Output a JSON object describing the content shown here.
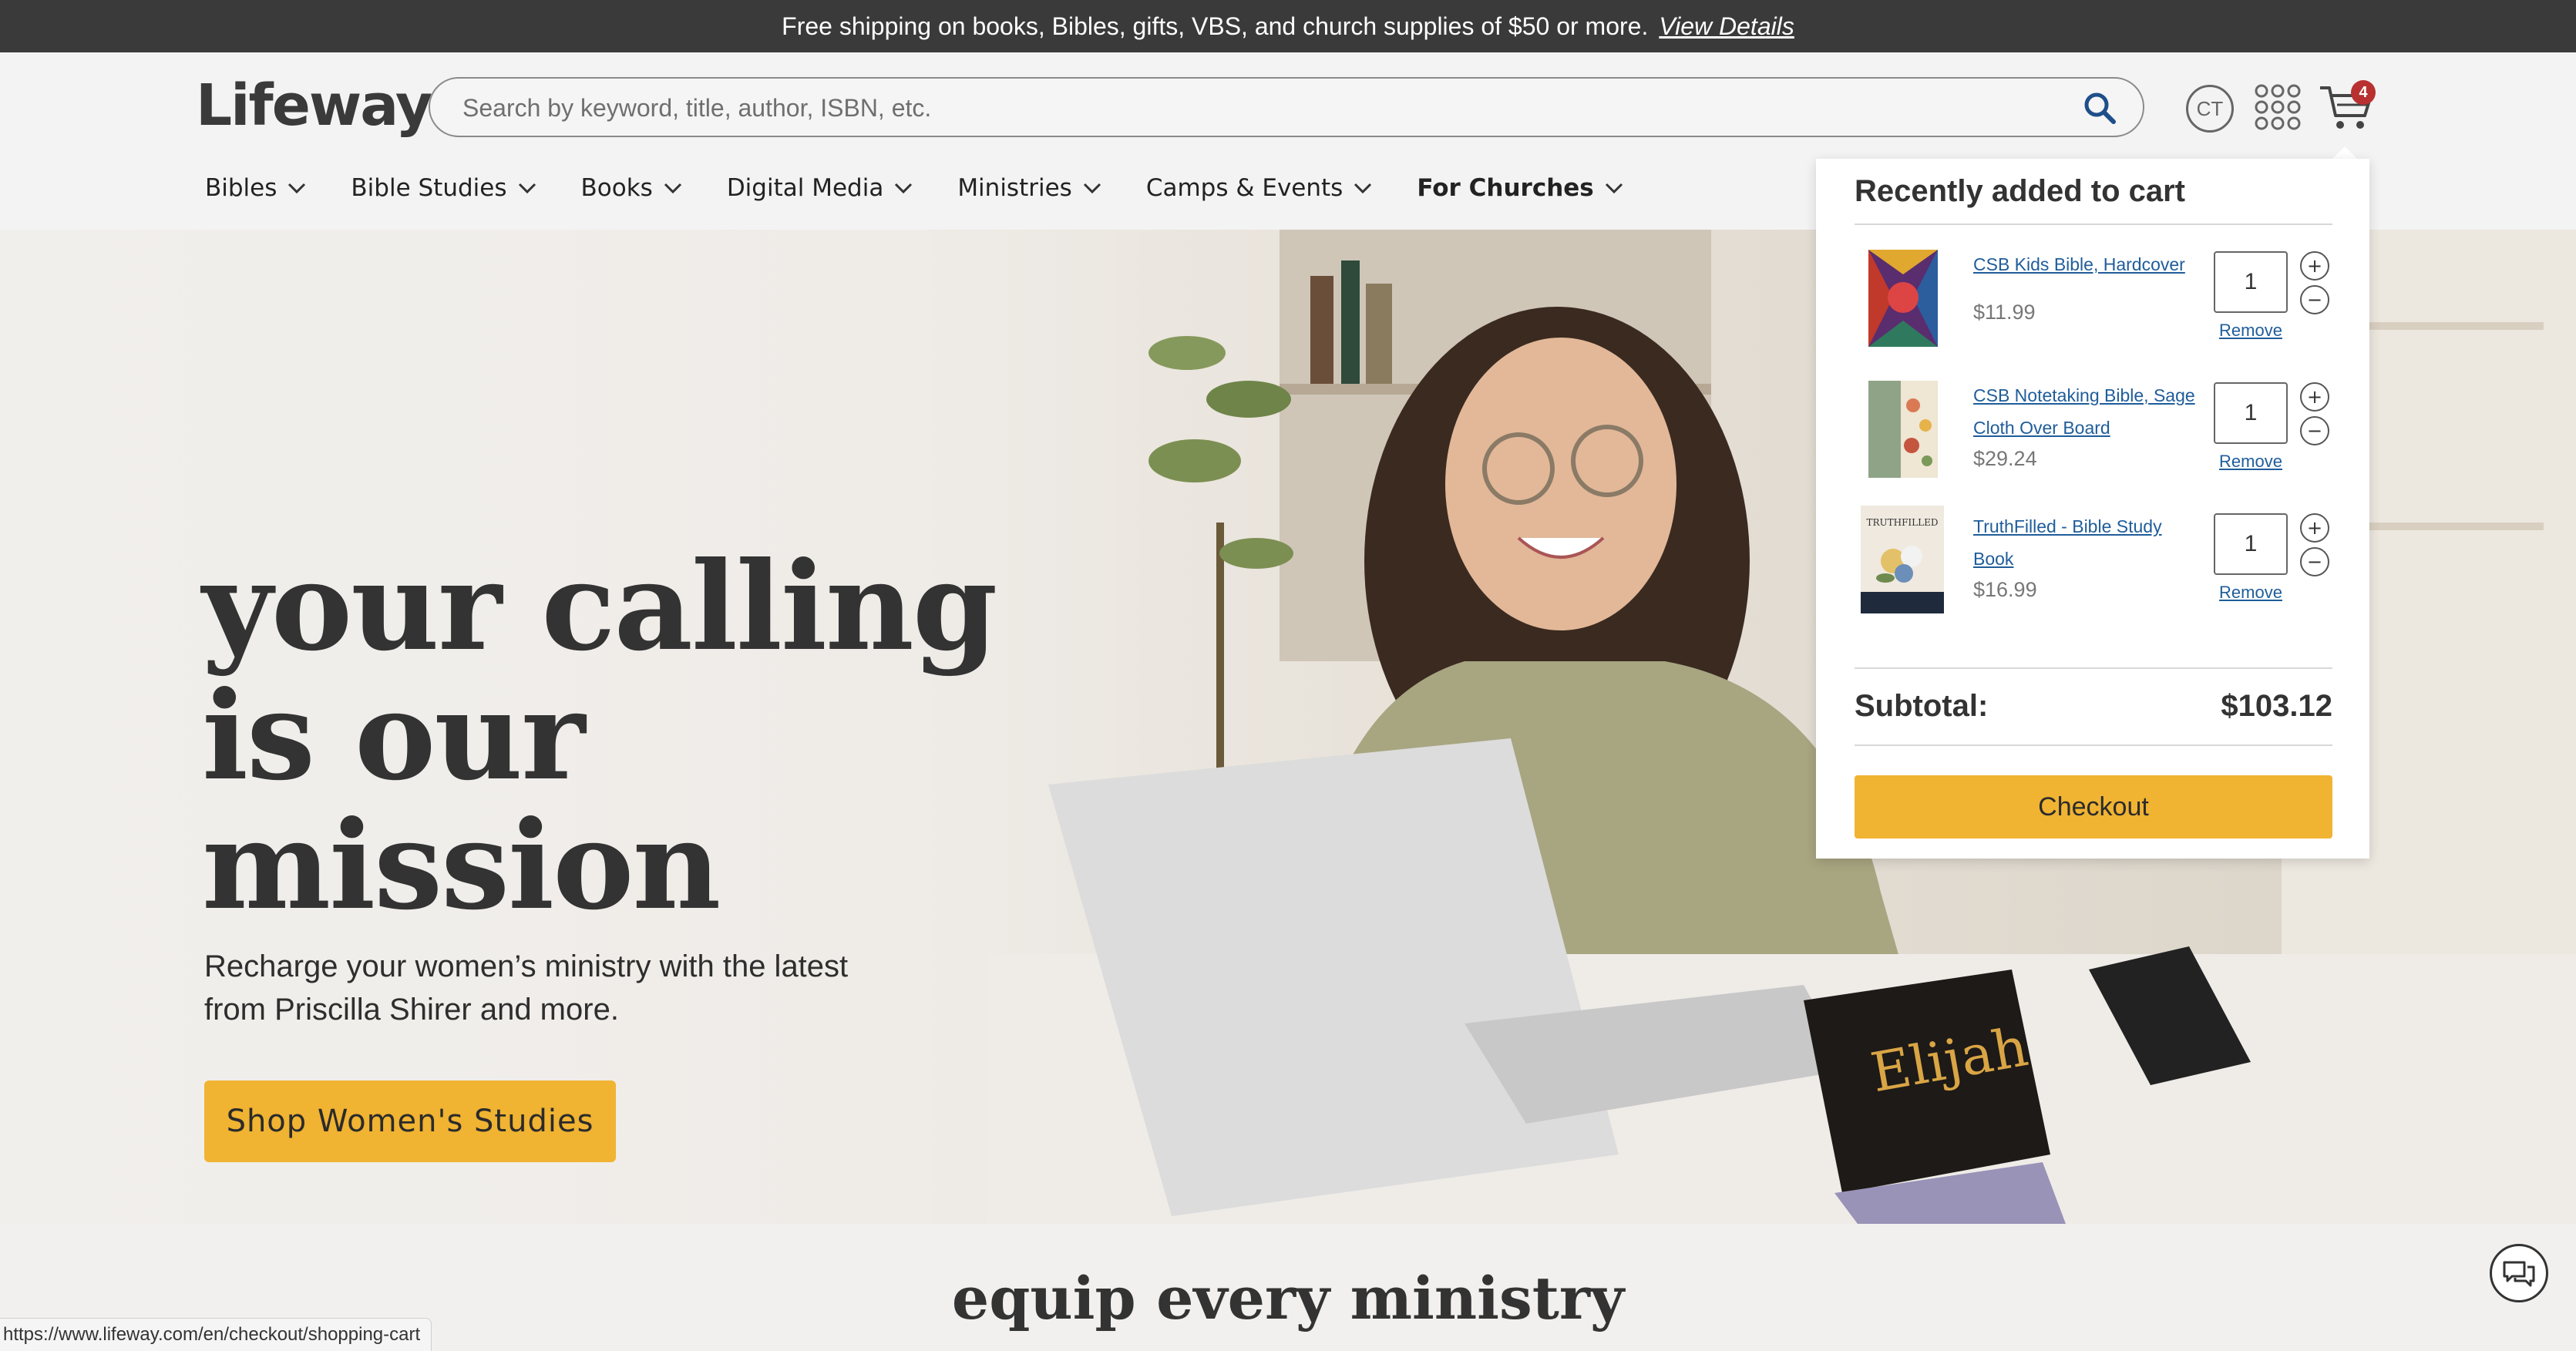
{
  "promo": {
    "text": "Free shipping on books, Bibles, gifts, VBS, and church supplies of $50 or more.",
    "link": "View Details"
  },
  "header": {
    "logo": "Lifeway",
    "search_placeholder": "Search by keyword, title, author, ISBN, etc.",
    "avatar_initials": "CT",
    "cart_count": "4"
  },
  "nav": [
    {
      "label": "Bibles"
    },
    {
      "label": "Bible Studies"
    },
    {
      "label": "Books"
    },
    {
      "label": "Digital Media"
    },
    {
      "label": "Ministries"
    },
    {
      "label": "Camps & Events"
    },
    {
      "label": "For Churches"
    }
  ],
  "hero": {
    "title_line1": "your calling",
    "title_line2": "is our",
    "title_line3": "mission",
    "subtitle": "Recharge your women’s ministry with the latest from Priscilla Shirer and more.",
    "cta": "Shop Women's Studies"
  },
  "minicart": {
    "title": "Recently added to cart",
    "items": [
      {
        "name": "CSB Kids Bible, Hardcover",
        "price": "$11.99",
        "qty": "1",
        "remove": "Remove"
      },
      {
        "name": "CSB Notetaking Bible, Sage Cloth Over Board",
        "price": "$29.24",
        "qty": "1",
        "remove": "Remove"
      },
      {
        "name": "TruthFilled - Bible Study Book",
        "price": "$16.99",
        "qty": "1",
        "remove": "Remove"
      }
    ],
    "subtotal_label": "Subtotal:",
    "subtotal_value": "$103.12",
    "checkout": "Checkout",
    "plus_symbol": "+",
    "minus_symbol": "−",
    "book3_cover_text": "TRUTHFILLED"
  },
  "section_title": "equip every ministry",
  "status_url": "https://www.lifeway.com/en/checkout/shopping-cart",
  "colors": {
    "promo_bg": "#3a3a3a",
    "accent": "#f0b332",
    "link": "#1f5d9a",
    "badge": "#b83030"
  }
}
